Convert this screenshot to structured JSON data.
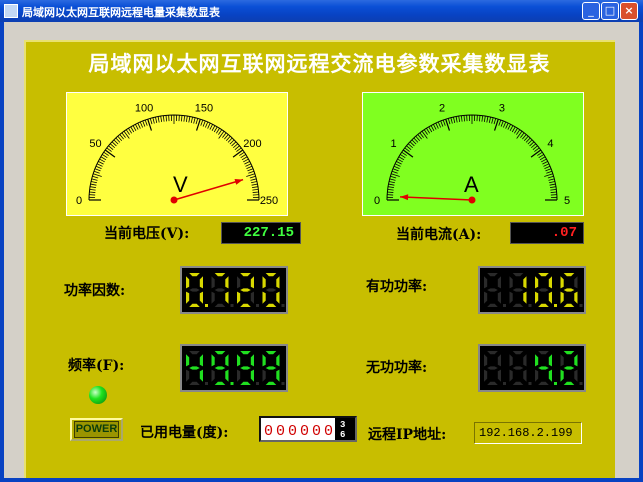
{
  "window": {
    "title": "局域网以太网互联网远程电量采集数显表"
  },
  "main_title": "局域网以太网互联网远程交流电参数采集数显表",
  "voltmeter": {
    "ticks": [
      "0",
      "50",
      "100",
      "150",
      "200",
      "250"
    ],
    "unit": "V",
    "min": 0,
    "max": 250,
    "value": 227.15,
    "face_color": "#ffff40"
  },
  "ammeter": {
    "ticks": [
      "0",
      "1",
      "2",
      "3",
      "4",
      "5"
    ],
    "unit": "A",
    "min": 0,
    "max": 5,
    "value": 0.07,
    "face_color": "#80ff20"
  },
  "voltage": {
    "label": "当前电压(V):",
    "value": "227.15",
    "color": "#40ff40"
  },
  "current": {
    "label": "当前电流(A):",
    "value": ".07",
    "color": "#ff2020"
  },
  "power_factor": {
    "label": "功率因数:",
    "value": "0.720",
    "color": "#d8d800"
  },
  "active_power": {
    "label": "有功功率:",
    "value": "10.6",
    "color": "#d8d800"
  },
  "frequency": {
    "label": "频率(F):",
    "value": "49.99",
    "color": "#20e020"
  },
  "reactive_power": {
    "label": "无功功率:",
    "value": "4.2",
    "color": "#20e020"
  },
  "power_button": {
    "label": "POWER"
  },
  "energy": {
    "label": "已用电量(度):",
    "digits": [
      "0",
      "0",
      "0",
      "0",
      "0",
      "0"
    ],
    "last_digits": [
      "3",
      "6"
    ]
  },
  "remote_ip": {
    "label": "远程IP地址:",
    "value": "192.168.2.199"
  }
}
